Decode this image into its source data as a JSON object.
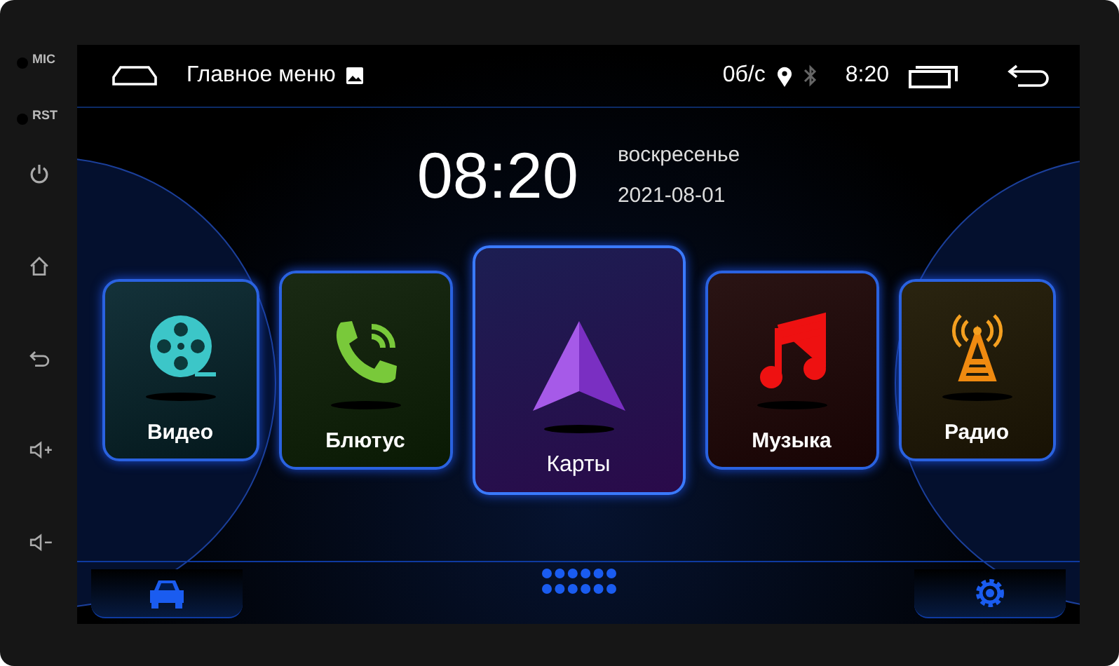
{
  "bezel": {
    "labels": [
      "MIC",
      "RST"
    ]
  },
  "status_bar": {
    "title": "Главное меню",
    "speed": "0б/с",
    "time": "8:20"
  },
  "clock": {
    "time": "08:20",
    "weekday": "воскресенье",
    "date": "2021-08-01"
  },
  "apps": [
    {
      "kind": "video",
      "label": "Видео",
      "selected": false
    },
    {
      "kind": "phone",
      "label": "Блютус",
      "selected": false
    },
    {
      "kind": "maps",
      "label": "Карты",
      "selected": true
    },
    {
      "kind": "music",
      "label": "Музыка",
      "selected": false
    },
    {
      "kind": "radio",
      "label": "Радио",
      "selected": false
    }
  ]
}
